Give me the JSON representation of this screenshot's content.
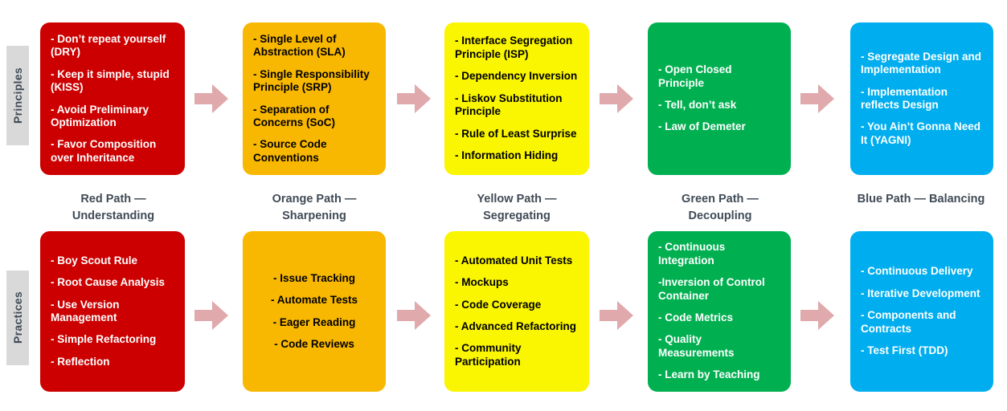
{
  "colors": {
    "red": "#CC0000",
    "orange": "#F8B700",
    "yellow": "#FAF500",
    "green": "#00B050",
    "blue": "#00AEEF",
    "arrow": "#E0A9AC",
    "label_text": "#404B56",
    "label_box": "#D9D9D9"
  },
  "rows": {
    "principles_label": "Principles",
    "practices_label": "Practices"
  },
  "paths": [
    {
      "label_line1": "Red Path —",
      "label_line2": "Understanding"
    },
    {
      "label_line1": "Orange Path —",
      "label_line2": "Sharpening"
    },
    {
      "label_line1": "Yellow Path —",
      "label_line2": "Segregating"
    },
    {
      "label_line1": "Green Path —",
      "label_line2": "Decoupling"
    },
    {
      "label_line1": "Blue Path — Balancing",
      "label_line2": ""
    }
  ],
  "principles": {
    "red": [
      "- Don’t repeat yourself (DRY)",
      "- Keep it simple, stupid (KISS)",
      "- Avoid Preliminary Optimization",
      "- Favor Composition over Inheritance"
    ],
    "orange": [
      "- Single Level of Abstraction (SLA)",
      "- Single Responsibility Principle (SRP)",
      "- Separation of Concerns (SoC)",
      "-  Source Code Conventions"
    ],
    "yellow": [
      "- Interface Segregation Principle (ISP)",
      "- Dependency Inversion",
      "- Liskov Substitution Principle",
      "- Rule of Least Surprise",
      "- Information Hiding"
    ],
    "green": [
      "- Open Closed Principle",
      "- Tell, don’t ask",
      "- Law of Demeter"
    ],
    "blue": [
      "- Segregate Design and Implementation",
      "- Implementation reflects Design",
      "- You Ain’t Gonna Need It (YAGNI)"
    ]
  },
  "practices": {
    "red": [
      "- Boy Scout Rule",
      "- Root Cause Analysis",
      "- Use Version Management",
      "- Simple Refactoring",
      "- Reflection"
    ],
    "orange": [
      "- Issue Tracking",
      "- Automate Tests",
      "- Eager Reading",
      "- Code Reviews"
    ],
    "yellow": [
      "- Automated Unit Tests",
      "- Mockups",
      "- Code Coverage",
      "- Advanced Refactoring",
      "- Community Participation"
    ],
    "green": [
      "- Continuous Integration",
      "-Inversion of Control Container",
      "- Code Metrics",
      "- Quality Measurements",
      "- Learn by Teaching"
    ],
    "blue": [
      "- Continuous Delivery",
      "- Iterative Development",
      "- Components and Contracts",
      "- Test First (TDD)"
    ]
  },
  "arrows": {
    "icon": "right-block-arrow-icon",
    "count": 8
  }
}
